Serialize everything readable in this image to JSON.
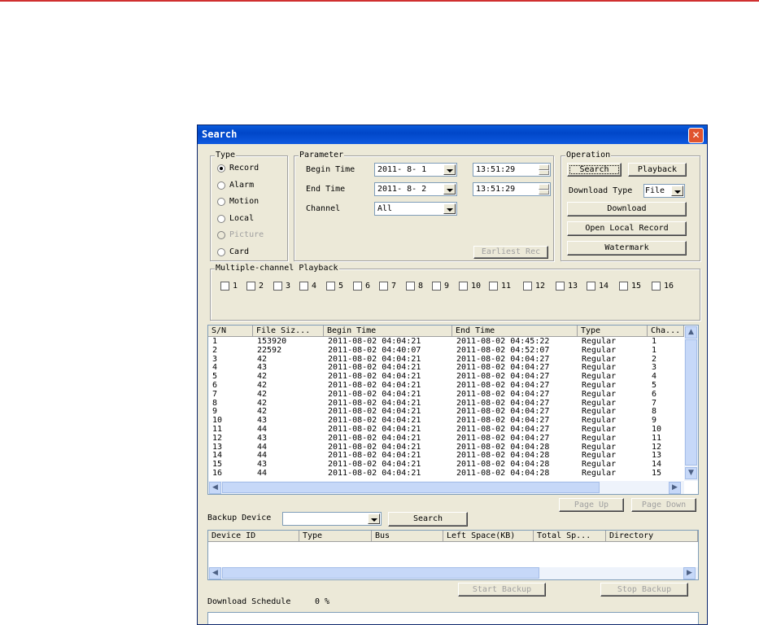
{
  "window": {
    "title": "Search",
    "close_symbol": "✕"
  },
  "type_group": {
    "legend": "Type",
    "options": [
      {
        "label": "Record",
        "selected": true,
        "enabled": true
      },
      {
        "label": "Alarm",
        "selected": false,
        "enabled": true
      },
      {
        "label": "Motion",
        "selected": false,
        "enabled": true
      },
      {
        "label": "Local",
        "selected": false,
        "enabled": true
      },
      {
        "label": "Picture",
        "selected": false,
        "enabled": false
      },
      {
        "label": "Card",
        "selected": false,
        "enabled": true
      }
    ]
  },
  "parameter": {
    "legend": "Parameter",
    "begin_time_label": "Begin Time",
    "begin_date": "2011- 8- 1",
    "begin_time": "13:51:29",
    "end_time_label": "End Time",
    "end_date": "2011- 8- 2",
    "end_time": "13:51:29",
    "channel_label": "Channel",
    "channel_value": "All",
    "earliest_label": "Earliest Rec"
  },
  "operation": {
    "legend": "Operation",
    "search": "Search",
    "playback": "Playback",
    "download_type_label": "Download Type",
    "download_type_value": "File",
    "download": "Download",
    "open_local_record": "Open Local Record",
    "watermark": "Watermark"
  },
  "multi_channel": {
    "legend": "Multiple-channel Playback",
    "channels": [
      "1",
      "2",
      "3",
      "4",
      "5",
      "6",
      "7",
      "8",
      "9",
      "10",
      "11",
      "12",
      "13",
      "14",
      "15",
      "16"
    ]
  },
  "records": {
    "columns": [
      "S/N",
      "File Siz...",
      "Begin Time",
      "End Time",
      "Type",
      "Cha..."
    ],
    "rows": [
      [
        "1",
        "153920",
        "2011-08-02 04:04:21",
        "2011-08-02 04:45:22",
        "Regular",
        "1"
      ],
      [
        "2",
        "22592",
        "2011-08-02 04:40:07",
        "2011-08-02 04:52:07",
        "Regular",
        "1"
      ],
      [
        "3",
        "42",
        "2011-08-02 04:04:21",
        "2011-08-02 04:04:27",
        "Regular",
        "2"
      ],
      [
        "4",
        "43",
        "2011-08-02 04:04:21",
        "2011-08-02 04:04:27",
        "Regular",
        "3"
      ],
      [
        "5",
        "42",
        "2011-08-02 04:04:21",
        "2011-08-02 04:04:27",
        "Regular",
        "4"
      ],
      [
        "6",
        "42",
        "2011-08-02 04:04:21",
        "2011-08-02 04:04:27",
        "Regular",
        "5"
      ],
      [
        "7",
        "42",
        "2011-08-02 04:04:21",
        "2011-08-02 04:04:27",
        "Regular",
        "6"
      ],
      [
        "8",
        "42",
        "2011-08-02 04:04:21",
        "2011-08-02 04:04:27",
        "Regular",
        "7"
      ],
      [
        "9",
        "42",
        "2011-08-02 04:04:21",
        "2011-08-02 04:04:27",
        "Regular",
        "8"
      ],
      [
        "10",
        "43",
        "2011-08-02 04:04:21",
        "2011-08-02 04:04:27",
        "Regular",
        "9"
      ],
      [
        "11",
        "44",
        "2011-08-02 04:04:21",
        "2011-08-02 04:04:27",
        "Regular",
        "10"
      ],
      [
        "12",
        "43",
        "2011-08-02 04:04:21",
        "2011-08-02 04:04:27",
        "Regular",
        "11"
      ],
      [
        "13",
        "44",
        "2011-08-02 04:04:21",
        "2011-08-02 04:04:28",
        "Regular",
        "12"
      ],
      [
        "14",
        "44",
        "2011-08-02 04:04:21",
        "2011-08-02 04:04:28",
        "Regular",
        "13"
      ],
      [
        "15",
        "43",
        "2011-08-02 04:04:21",
        "2011-08-02 04:04:28",
        "Regular",
        "14"
      ],
      [
        "16",
        "44",
        "2011-08-02 04:04:21",
        "2011-08-02 04:04:28",
        "Regular",
        "15"
      ]
    ],
    "page_up": "Page Up",
    "page_down": "Page Down"
  },
  "backup": {
    "device_label": "Backup Device",
    "device_value": "",
    "search": "Search",
    "columns": [
      "Device ID",
      "Type",
      "Bus",
      "Left Space(KB)",
      "Total Sp...",
      "Directory"
    ],
    "start": "Start Backup",
    "stop": "Stop Backup"
  },
  "schedule": {
    "label": "Download Schedule",
    "value": "0 %"
  },
  "colors": {
    "title_bar": "#0046c8",
    "window_bg": "#ece9d8",
    "close": "#e0542f",
    "top_rule": "#d03030"
  },
  "icons": {
    "close": "close-icon",
    "scroll_up": "arrow-up-icon",
    "scroll_down": "arrow-down-icon",
    "scroll_left": "arrow-left-icon",
    "scroll_right": "arrow-right-icon"
  }
}
